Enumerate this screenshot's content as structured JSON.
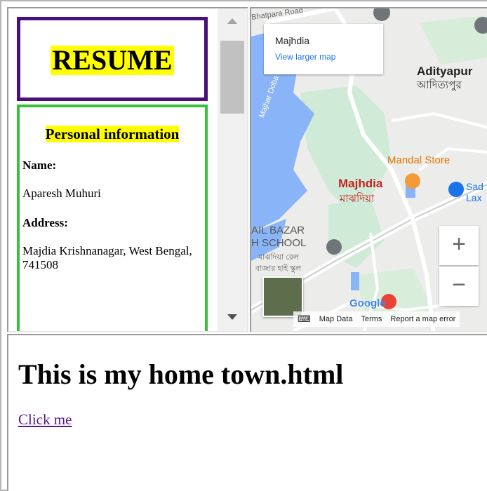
{
  "resume": {
    "title": "RESUME",
    "section_heading": "Personal information",
    "name_label": "Name:",
    "name_value": "Aparesh Muhuri",
    "address_label": "Address:",
    "address_value": "Majdia Krishnanagar, West Bengal, 741508"
  },
  "map": {
    "card": {
      "place": "Majhdia",
      "link": "View larger map"
    },
    "labels": {
      "road": "Bhatpara Road",
      "town_en": "Adityapur",
      "town_bn": "আদিত্যপুর",
      "store": "Mandal Store",
      "main_en": "Majhdia",
      "main_bn": "মাঝদিয়া",
      "school_en_1": "AIL BAZAR",
      "school_en_2": "H SCHOOL",
      "school_bn_1": "মাঝদিয়া রেল",
      "school_bn_2": "বাজার হাই স্কুল",
      "sad": "Sad",
      "lax": "Lax",
      "road_side": "Majhar Doba",
      "google": "Google"
    },
    "zoom_in": "+",
    "zoom_out": "−",
    "attribution": {
      "map_data": "Map Data",
      "terms": "Terms",
      "report": "Report a map error"
    },
    "colors": {
      "water": "#8ab4f8",
      "green": "#c8e6c9",
      "land": "#ecedeb"
    }
  },
  "bottom": {
    "heading": "This is my home town.html",
    "link": "Click me"
  }
}
